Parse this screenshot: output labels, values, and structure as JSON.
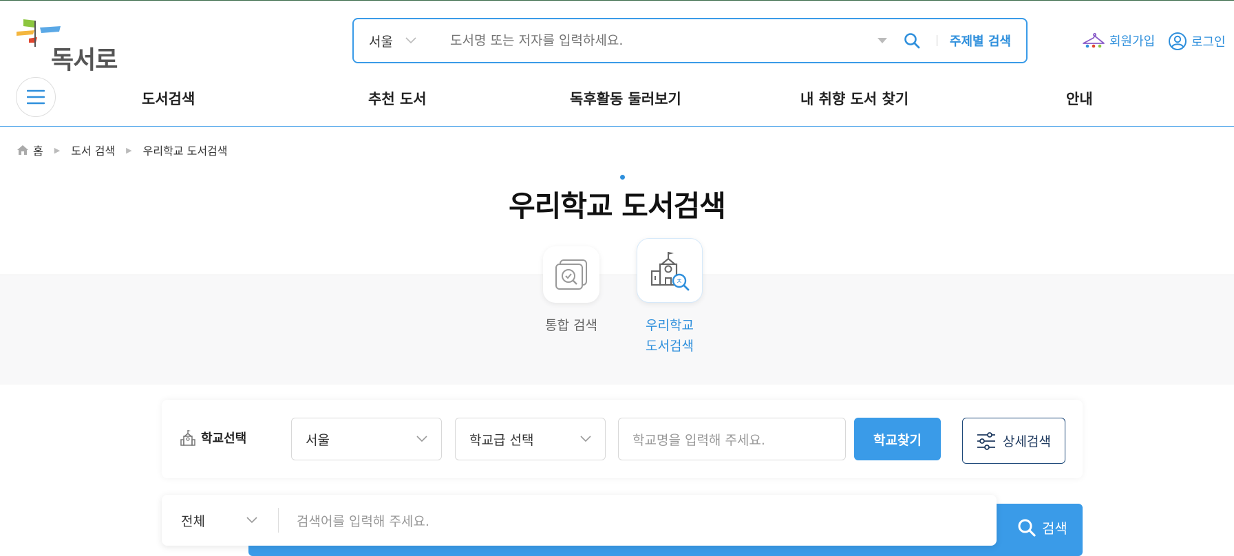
{
  "header": {
    "logo_text": "독서로",
    "search": {
      "region": "서울",
      "placeholder": "도서명 또는 저자를 입력하세요.",
      "topic_search_label": "주제별 검색"
    },
    "join_label": "회원가입",
    "login_label": "로그인"
  },
  "nav": {
    "items": [
      "도서검색",
      "추천 도서",
      "독후활동 둘러보기",
      "내 취향 도서 찾기",
      "안내"
    ]
  },
  "breadcrumb": [
    "홈",
    "도서 검색",
    "우리학교 도서검색"
  ],
  "page_title": "우리학교 도서검색",
  "tabs": [
    {
      "label": "통합 검색",
      "active": false
    },
    {
      "label_line1": "우리학교",
      "label_line2": "도서검색",
      "active": true
    }
  ],
  "school_select": {
    "label": "학교선택",
    "region": "서울",
    "level": "학교급 선택",
    "name_placeholder": "학교명을 입력해 주세요.",
    "find_button": "학교찾기",
    "detail_button": "상세검색"
  },
  "main_search": {
    "scope": "전체",
    "placeholder": "검색어를 입력해 주세요.",
    "button": "검색"
  },
  "colors": {
    "accent": "#3a9be8",
    "accent_text": "#2e8fdc",
    "navy": "#1f4a7a"
  }
}
